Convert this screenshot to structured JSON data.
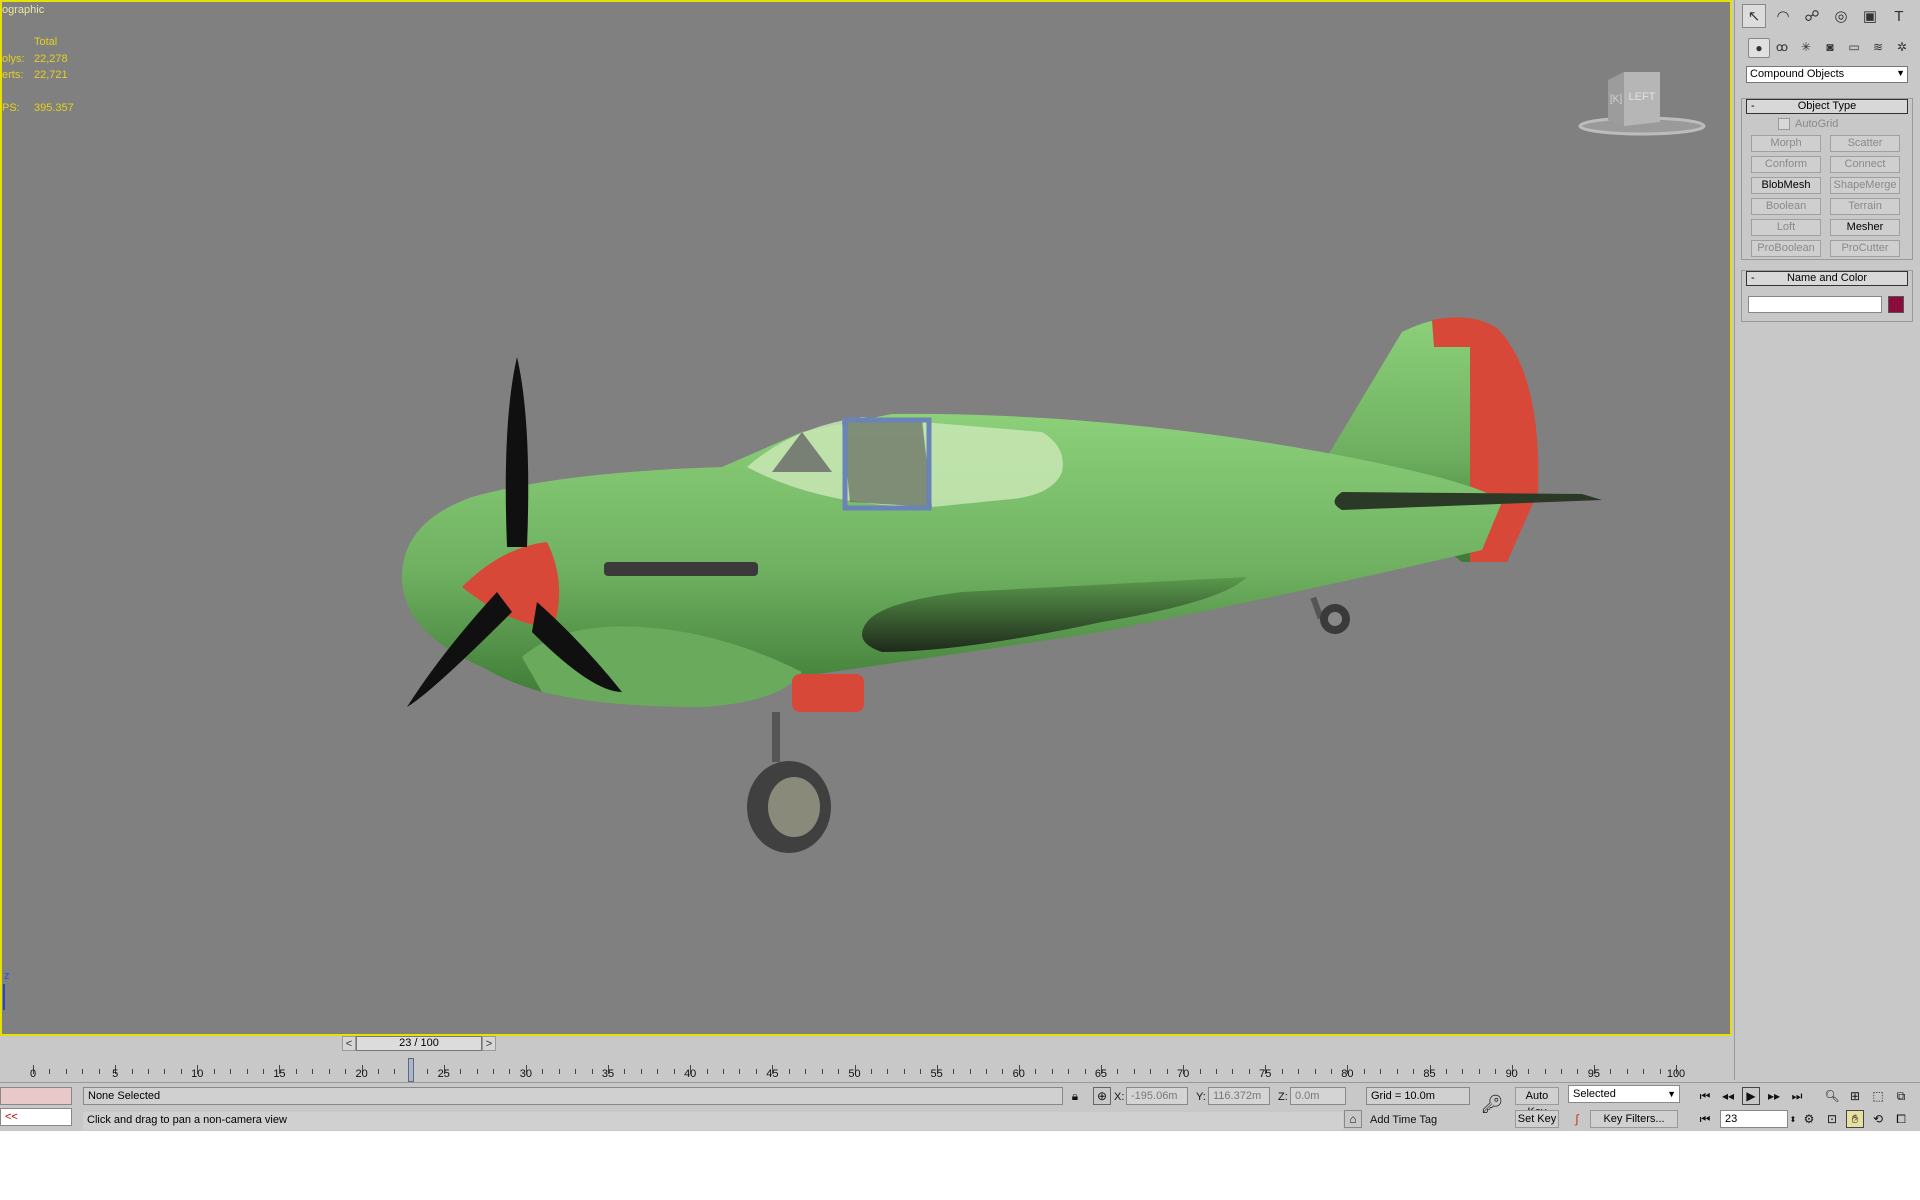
{
  "viewport": {
    "label": "ographic",
    "stats": {
      "header": "Total",
      "polys_label": "olys:",
      "polys_value": "22,278",
      "verts_label": "erts:",
      "verts_value": "22,721",
      "fps_label": "PS:",
      "fps_value": "395.357"
    },
    "viewcube": {
      "face_front": "[K]",
      "face_left": "LEFT"
    },
    "axis_label": "z"
  },
  "command_panel": {
    "tabs": [
      {
        "icon": "create-icon",
        "glyph": "↖"
      },
      {
        "icon": "modify-icon",
        "glyph": "◠"
      },
      {
        "icon": "hierarchy-icon",
        "glyph": "☍"
      },
      {
        "icon": "motion-icon",
        "glyph": "◎"
      },
      {
        "icon": "display-icon",
        "glyph": "▣"
      },
      {
        "icon": "utilities-icon",
        "glyph": "T"
      }
    ],
    "sub_tabs": [
      {
        "icon": "geometry-icon",
        "glyph": "●"
      },
      {
        "icon": "shapes-icon",
        "glyph": "ꝏ"
      },
      {
        "icon": "lights-icon",
        "glyph": "✳"
      },
      {
        "icon": "cameras-icon",
        "glyph": "◙"
      },
      {
        "icon": "helpers-icon",
        "glyph": "▭"
      },
      {
        "icon": "spacewarps-icon",
        "glyph": "≋"
      },
      {
        "icon": "systems-icon",
        "glyph": "✲"
      }
    ],
    "category": "Compound Objects",
    "object_type": {
      "title": "Object Type",
      "autogrid": "AutoGrid",
      "buttons": [
        {
          "label": "Morph",
          "enabled": false
        },
        {
          "label": "Scatter",
          "enabled": false
        },
        {
          "label": "Conform",
          "enabled": false
        },
        {
          "label": "Connect",
          "enabled": false
        },
        {
          "label": "BlobMesh",
          "enabled": true
        },
        {
          "label": "ShapeMerge",
          "enabled": false
        },
        {
          "label": "Boolean",
          "enabled": false
        },
        {
          "label": "Terrain",
          "enabled": false
        },
        {
          "label": "Loft",
          "enabled": false
        },
        {
          "label": "Mesher",
          "enabled": true
        },
        {
          "label": "ProBoolean",
          "enabled": false
        },
        {
          "label": "ProCutter",
          "enabled": false
        }
      ]
    },
    "name_color": {
      "title": "Name and Color",
      "name_value": "",
      "color": "#8a0c3a"
    },
    "minus": "-"
  },
  "timeline": {
    "slider_label": "23 / 100",
    "prev": "<",
    "next": ">",
    "labels": [
      "0",
      "5",
      "10",
      "15",
      "20",
      "25",
      "30",
      "35",
      "40",
      "45",
      "50",
      "55",
      "60",
      "65",
      "70",
      "75",
      "80",
      "85",
      "90",
      "95",
      "100"
    ],
    "current_frame": 23
  },
  "status": {
    "selection": "None Selected",
    "prompt": "Click and drag to pan a non-camera view",
    "maxscript_arrow": "<<",
    "x_label": "X:",
    "x_value": "-195.06m",
    "y_label": "Y:",
    "y_value": "116.372m",
    "z_label": "Z:",
    "z_value": "0.0m",
    "grid": "Grid = 10.0m",
    "add_time_tag": "Add Time Tag",
    "auto_key": "Auto Key",
    "set_key": "Set Key",
    "key_mode": "Selected",
    "key_filters": "Key Filters...",
    "frame_value": "23"
  },
  "colors": {
    "viewport_bg": "#808080",
    "viewport_border": "#e8e000",
    "stats_text": "#e4d020",
    "plane_green": "#7cbc6c",
    "plane_red": "#d84838"
  }
}
